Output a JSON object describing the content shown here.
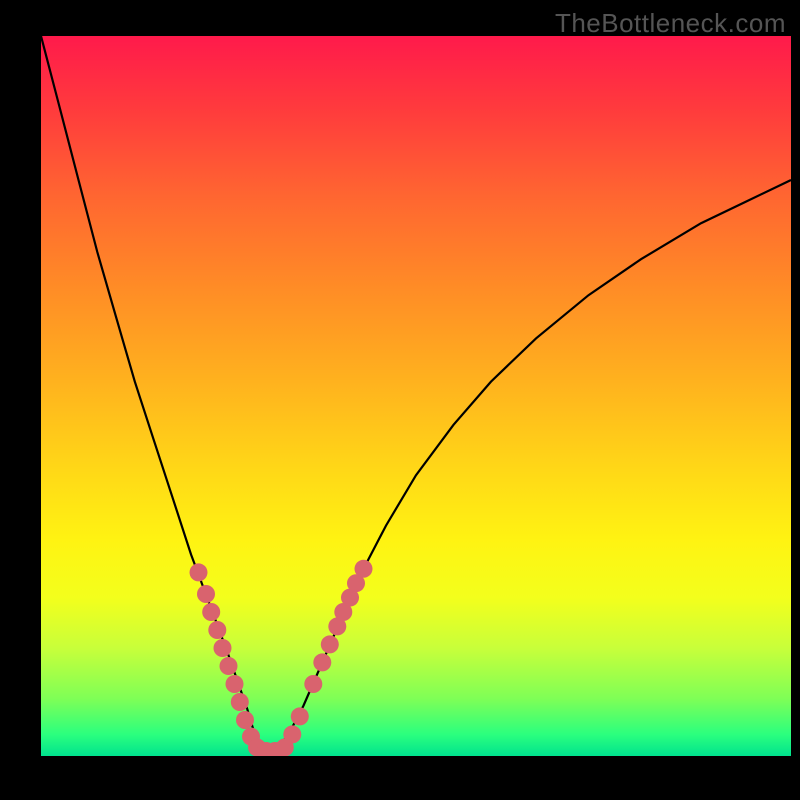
{
  "watermark": "TheBottleneck.com",
  "chart_data": {
    "type": "line",
    "title": "",
    "xlabel": "",
    "ylabel": "",
    "xlim": [
      0,
      100
    ],
    "ylim": [
      0,
      100
    ],
    "series": [
      {
        "name": "bottleneck-curve",
        "color": "#000000",
        "x": [
          0,
          2.5,
          5,
          7.5,
          10,
          12.5,
          15,
          17.5,
          20,
          22.5,
          25,
          27.5,
          28.5,
          29.5,
          31,
          33,
          35,
          37.5,
          40,
          42.5,
          46,
          50,
          55,
          60,
          66,
          73,
          80,
          88,
          94,
          100
        ],
        "values": [
          100,
          90,
          80,
          70,
          61,
          52,
          44,
          36,
          28,
          21,
          14,
          6.5,
          3,
          0.5,
          0.5,
          3,
          7,
          13,
          19,
          25,
          32,
          39,
          46,
          52,
          58,
          64,
          69,
          74,
          77,
          80
        ]
      }
    ],
    "markers": [
      {
        "name": "dot-cluster",
        "color": "#d9636e",
        "radius": 9,
        "points": [
          {
            "x": 21.0,
            "y": 25.5
          },
          {
            "x": 22.0,
            "y": 22.5
          },
          {
            "x": 22.7,
            "y": 20.0
          },
          {
            "x": 23.5,
            "y": 17.5
          },
          {
            "x": 24.2,
            "y": 15.0
          },
          {
            "x": 25.0,
            "y": 12.5
          },
          {
            "x": 25.8,
            "y": 10.0
          },
          {
            "x": 26.5,
            "y": 7.5
          },
          {
            "x": 27.2,
            "y": 5.0
          },
          {
            "x": 28.0,
            "y": 2.7
          },
          {
            "x": 28.8,
            "y": 1.2
          },
          {
            "x": 30.0,
            "y": 0.7
          },
          {
            "x": 31.2,
            "y": 0.7
          },
          {
            "x": 32.5,
            "y": 1.2
          },
          {
            "x": 33.5,
            "y": 3.0
          },
          {
            "x": 34.5,
            "y": 5.5
          },
          {
            "x": 36.3,
            "y": 10.0
          },
          {
            "x": 37.5,
            "y": 13.0
          },
          {
            "x": 38.5,
            "y": 15.5
          },
          {
            "x": 39.5,
            "y": 18.0
          },
          {
            "x": 40.3,
            "y": 20.0
          },
          {
            "x": 41.2,
            "y": 22.0
          },
          {
            "x": 42.0,
            "y": 24.0
          },
          {
            "x": 43.0,
            "y": 26.0
          }
        ]
      }
    ]
  }
}
